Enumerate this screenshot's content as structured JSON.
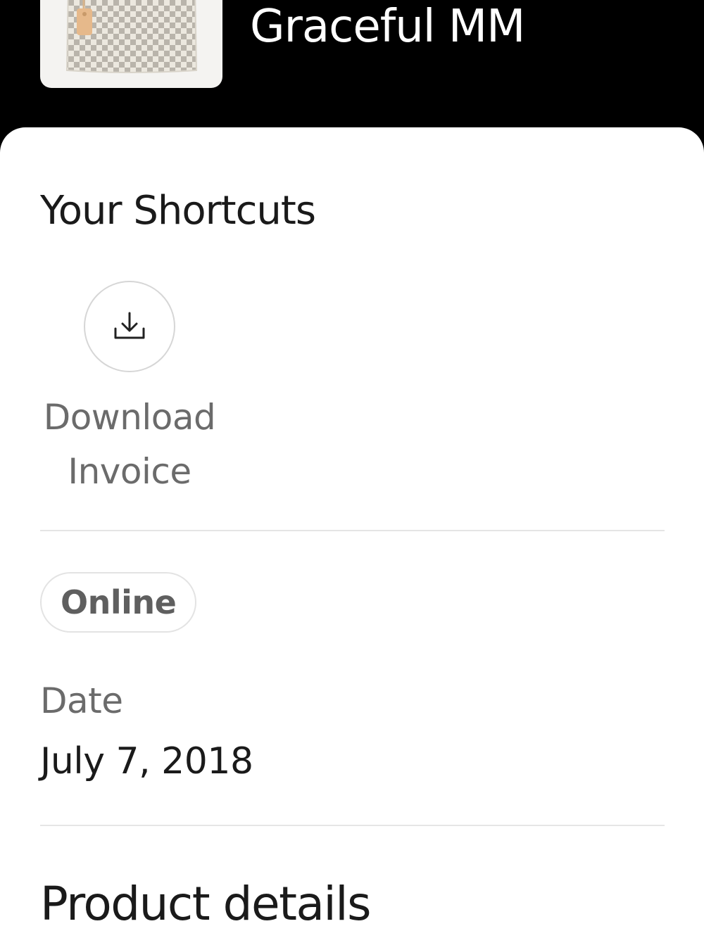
{
  "header": {
    "product_name": "Graceful MM"
  },
  "shortcuts": {
    "title": "Your Shortcuts",
    "items": [
      {
        "label": "Download Invoice",
        "icon": "download-icon"
      }
    ]
  },
  "order": {
    "channel": "Online",
    "date_label": "Date",
    "date_value": "July 7, 2018"
  },
  "product_details": {
    "title": "Product details"
  },
  "colors": {
    "header_background": "#000000",
    "card_background": "#ffffff",
    "primary_text": "#1a1a1a",
    "secondary_text": "#6b6b6b"
  }
}
